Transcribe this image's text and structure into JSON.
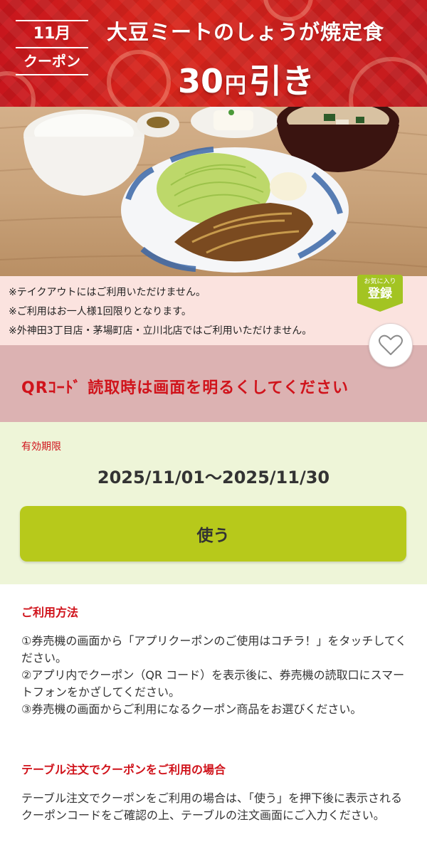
{
  "banner": {
    "month_label": "11月",
    "coupon_label": "クーポン",
    "title": "大豆ミートのしょうが焼定食",
    "discount_amount": "30",
    "discount_unit": "円",
    "discount_suffix": "引き"
  },
  "notes": [
    "※テイクアウトにはご利用いただけません。",
    "※ご利用はお一人様1回限りとなります。",
    "※外神田3丁目店・茅場町店・立川北店ではご利用いただけません。"
  ],
  "favorite_tag": {
    "small": "お気に入り",
    "big": "登録"
  },
  "qr_notice": "QRｺｰﾄﾞ 読取時は画面を明るくしてください",
  "validity": {
    "label": "有効期限",
    "range": "2025/11/01～2025/11/30"
  },
  "use_button_label": "使う",
  "how_to_use": {
    "title": "ご利用方法",
    "steps": [
      "①券売機の画面から「アプリクーポンのご使用はコチラ！」をタッチしてください。",
      "②アプリ内でクーポン（QR コード）を表示後に、券売機の読取口にスマートフォンをかざしてください。",
      "③券売機の画面からご利用になるクーポン商品をお選びください。"
    ]
  },
  "table_order": {
    "title": "テーブル注文でクーポンをご利用の場合",
    "body": "テーブル注文でクーポンをご利用の場合は、「使う」を押下後に表示されるクーポンコードをご確認の上、テーブルの注文画面にご入力ください。"
  },
  "colors": {
    "brand_red": "#d0131b",
    "button_green": "#b7c91b",
    "tag_green": "#a3c422",
    "qr_band": "#dcb2b2",
    "valid_band": "#eef5d8",
    "notes_band": "#fbe3df"
  },
  "icons": {
    "heart": "heart-outline-icon"
  }
}
